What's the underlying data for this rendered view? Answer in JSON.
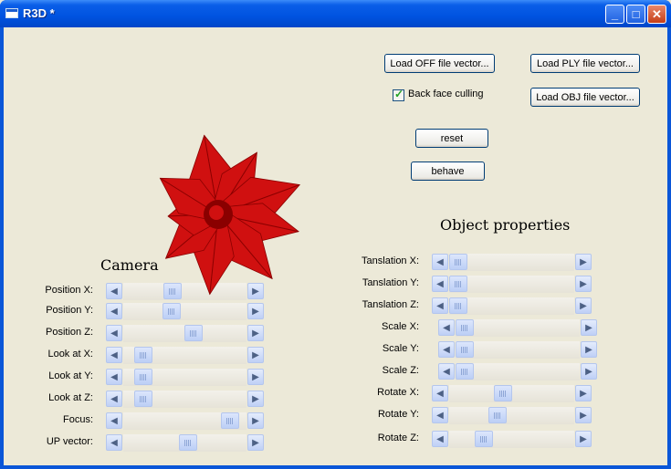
{
  "window": {
    "title": "R3D *"
  },
  "titlebar_buttons": {
    "minimize": "_",
    "maximize": "□",
    "close": "✕"
  },
  "buttons": {
    "load_off": "Load OFF file vector...",
    "load_ply": "Load PLY file vector...",
    "load_obj": "Load OBJ file vector...",
    "reset": "reset",
    "behave": "behave"
  },
  "back_face_culling": {
    "label": "Back face culling",
    "checked": true
  },
  "camera": {
    "heading": "Camera",
    "sliders": [
      {
        "label": "Position X:",
        "value": 0.38
      },
      {
        "label": "Position Y:",
        "value": 0.37
      },
      {
        "label": "Position Z:",
        "value": 0.58
      },
      {
        "label": "Look at X:",
        "value": 0.1
      },
      {
        "label": "Look at Y:",
        "value": 0.1
      },
      {
        "label": "Look at Z:",
        "value": 0.1
      },
      {
        "label": "Focus:",
        "value": 0.93
      },
      {
        "label": "UP vector:",
        "value": 0.53
      }
    ]
  },
  "object": {
    "heading": "Object properties",
    "sliders": [
      {
        "label": "Tanslation X:",
        "value": 0.0
      },
      {
        "label": "Tanslation Y:",
        "value": 0.0
      },
      {
        "label": "Tanslation Z:",
        "value": 0.0
      },
      {
        "label": "Scale X:",
        "value": 0.0
      },
      {
        "label": "Scale Y:",
        "value": 0.0
      },
      {
        "label": "Scale Z:",
        "value": 0.0
      },
      {
        "label": "Rotate X:",
        "value": 0.42
      },
      {
        "label": "Rotate Y:",
        "value": 0.37
      },
      {
        "label": "Rotate Z:",
        "value": 0.24
      }
    ]
  },
  "colors": {
    "flower": "#D01010",
    "flower_dark": "#8A0000",
    "accent": "#0A56D8"
  },
  "icons": {
    "scroll_left": "chevron-left-icon",
    "scroll_right": "chevron-right-icon"
  }
}
